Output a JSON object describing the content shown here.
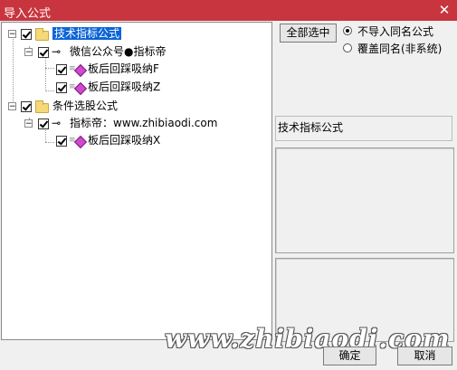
{
  "window": {
    "title": "导入公式",
    "close_glyph": "✕"
  },
  "tree": {
    "nodes": [
      {
        "label": "技术指标公式",
        "icon": "folder-icon",
        "expanded": true,
        "checked": true,
        "selected": true
      },
      {
        "label": "微信公众号●指标帝",
        "icon": "key-icon",
        "expanded": true,
        "checked": true
      },
      {
        "label": "板后回踩吸纳F",
        "icon": "diamond-icon",
        "checked": true
      },
      {
        "label": "板后回踩吸纳Z",
        "icon": "diamond-icon",
        "checked": true
      },
      {
        "label": "条件选股公式",
        "icon": "folder-icon",
        "expanded": true,
        "checked": true
      },
      {
        "label": "指标帝：www.zhibiaodi.com",
        "icon": "key-icon",
        "expanded": true,
        "checked": true
      },
      {
        "label": "板后回踩吸纳X",
        "icon": "diamond-icon",
        "checked": true
      }
    ]
  },
  "options": {
    "select_all_label": "全部选中",
    "radio_no_import_same": "不导入同名公式",
    "radio_overwrite_same": "覆盖同名(非系统)",
    "selected_radio": "no_import_same"
  },
  "info": {
    "category_label": "技术指标公式"
  },
  "footer": {
    "watermark": "www.zhibiaodi.com",
    "ok_label": "确定",
    "cancel_label": "取消"
  }
}
